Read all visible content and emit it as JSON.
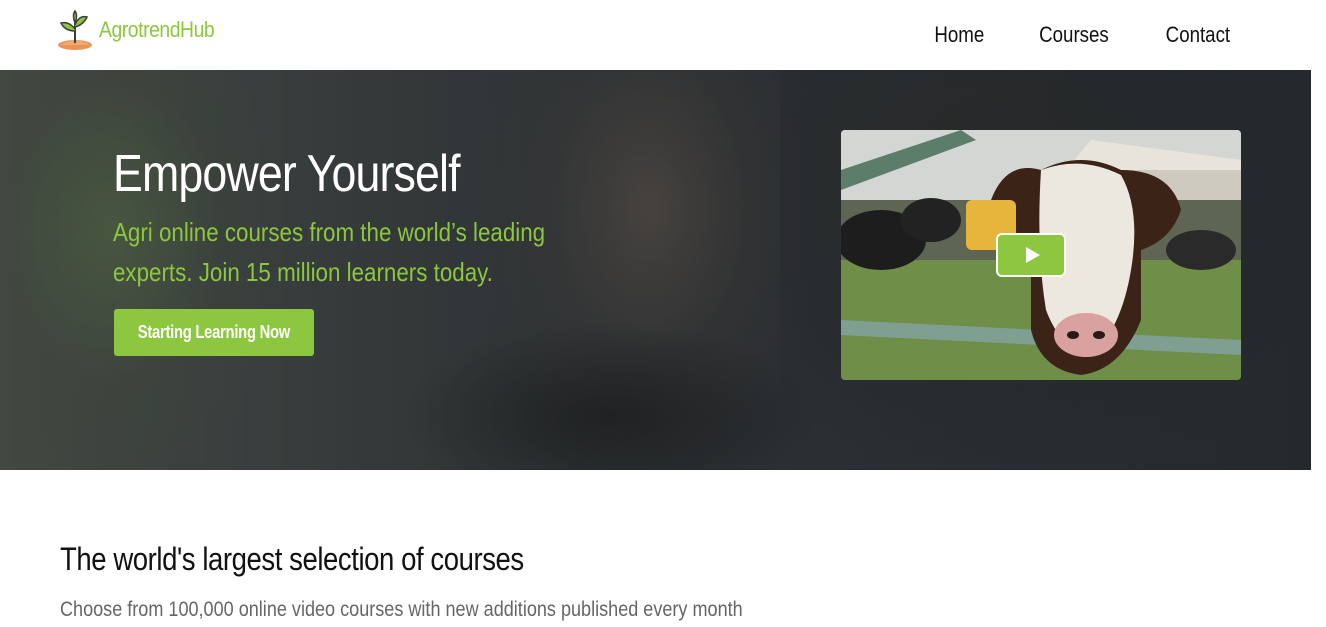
{
  "brand": {
    "name": "AgrotrendHub",
    "accent_color": "#8dc63f",
    "logo_icon": "sprout-icon"
  },
  "nav": {
    "items": [
      {
        "label": "Home"
      },
      {
        "label": "Courses"
      },
      {
        "label": "Contact"
      }
    ]
  },
  "hero": {
    "title": "Empower Yourself",
    "subtitle": "Agri online courses from the world’s leading experts. Join 15 million learners today.",
    "cta_label": "Starting Learning Now",
    "video": {
      "play_icon": "play-icon"
    }
  },
  "section": {
    "title": "The world's largest selection of courses",
    "subtitle": "Choose from 100,000 online video courses with new additions published every month"
  }
}
